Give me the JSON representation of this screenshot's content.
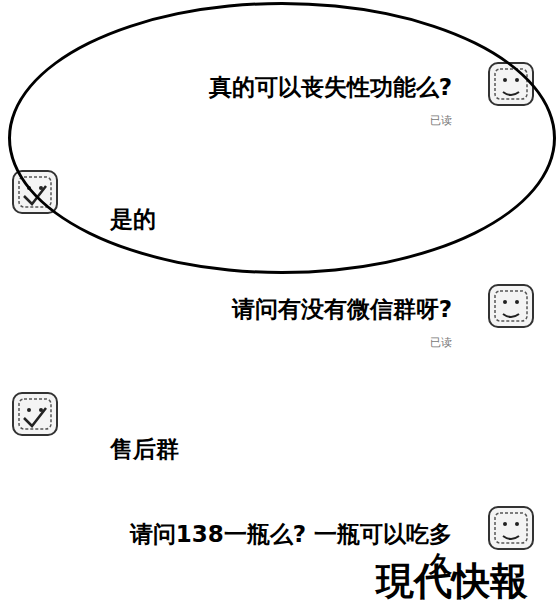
{
  "messages": [
    {
      "kind": "sent",
      "text": "真的可以丧失性功能么?",
      "receipt": "已读"
    },
    {
      "kind": "received",
      "text": "是的"
    },
    {
      "kind": "sent",
      "text": "请问有没有微信群呀?",
      "receipt": "已读"
    },
    {
      "kind": "received",
      "text": "售后群"
    },
    {
      "kind": "sent",
      "text": "请问138一瓶么? 一瓶可以吃多久"
    }
  ],
  "highlight": {
    "message": 0,
    "through": 1
  },
  "watermark": "現代快報"
}
